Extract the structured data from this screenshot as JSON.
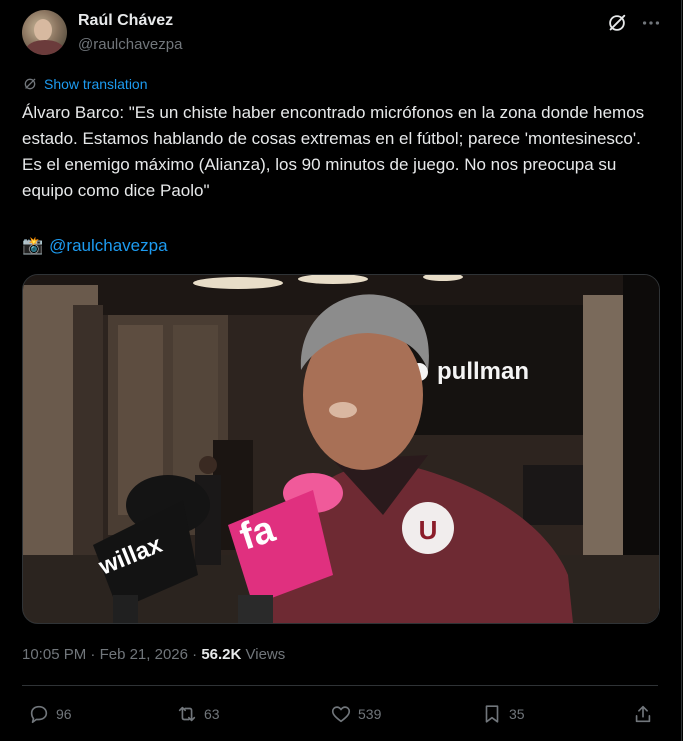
{
  "author": {
    "name": "Raúl Chávez",
    "handle": "@raulchavezpa"
  },
  "translate_label": "Show translation",
  "body": "Álvaro Barco: \"Es un chiste haber encontrado micrófonos en la zona donde hemos estado. Estamos hablando de cosas extremas en el fútbol; parece 'montesinesco'. Es el enemigo máximo (Alianza), los 90 minutos de juego. No nos preocupa su equipo como dice Paolo\"",
  "credit": {
    "emoji": "📸",
    "mention": "@raulchavezpa"
  },
  "media": {
    "sign_text": "pullman",
    "mic_left": "willax",
    "mic_right": "fa",
    "shirt_badge": "U"
  },
  "meta": {
    "time": "10:05 PM",
    "separator": "·",
    "date": "Feb 21, 2026",
    "views_count": "56.2K",
    "views_label": "Views"
  },
  "actions": {
    "replies": "96",
    "reposts": "63",
    "likes": "539",
    "bookmarks": "35"
  },
  "colors": {
    "accent": "#1d9bf0",
    "text": "#e7e9ea",
    "muted": "#71767b",
    "background": "#000000"
  }
}
